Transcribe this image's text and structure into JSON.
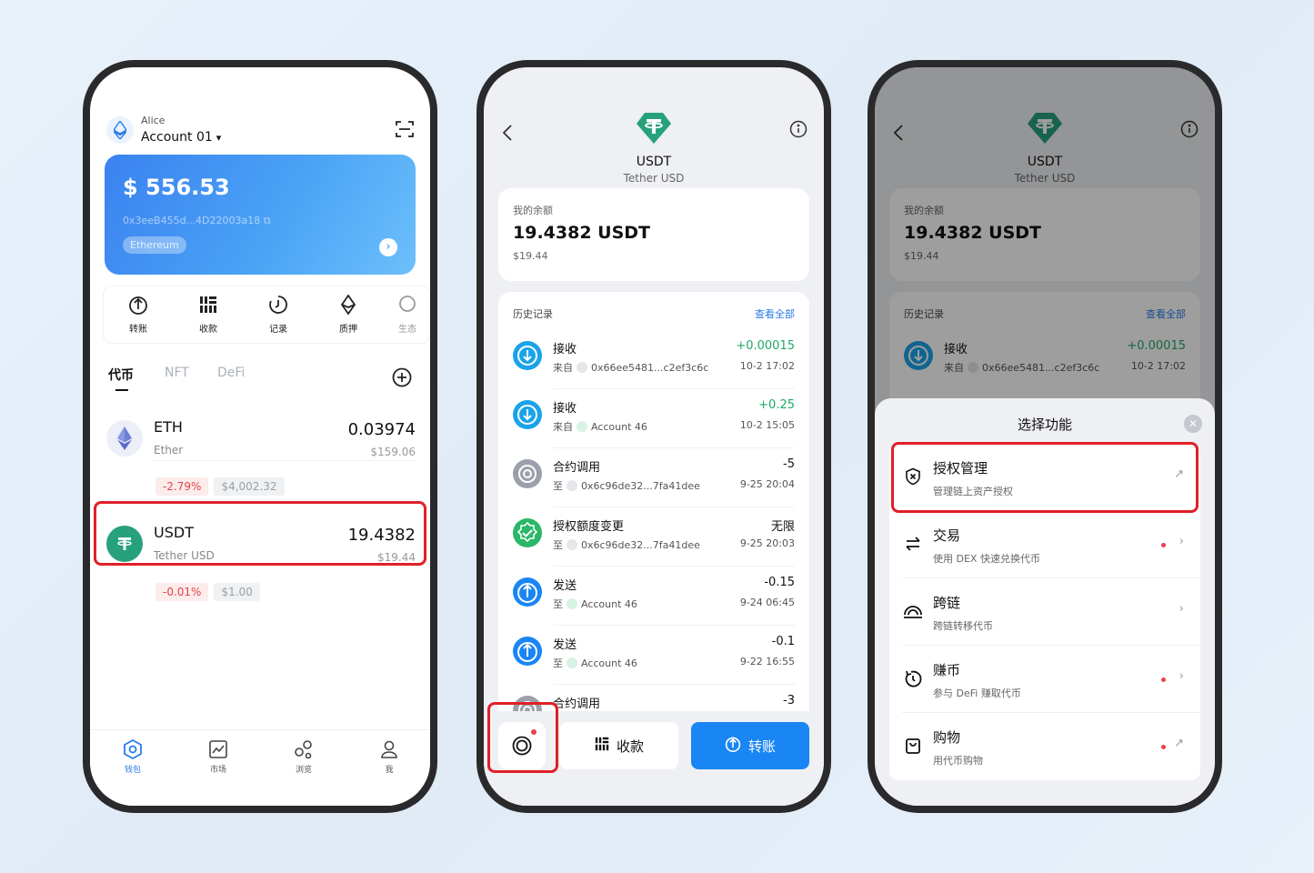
{
  "colors": {
    "accent": "#1a85f4",
    "positive": "#1fa868",
    "negative": "#e0454a",
    "highlight": "#e02028",
    "tether": "#26a17b"
  },
  "wallet": {
    "user": "Alice",
    "account": "Account 01",
    "balance": "$ 556.53",
    "address": "0x3eeB455d...4D22003a18",
    "network": "Ethereum",
    "actions": [
      {
        "label": "转账",
        "icon": "send-icon"
      },
      {
        "label": "收款",
        "icon": "qr-icon"
      },
      {
        "label": "记录",
        "icon": "history-icon"
      },
      {
        "label": "质押",
        "icon": "stake-icon"
      },
      {
        "label": "生态",
        "icon": "ecosystem-icon"
      }
    ],
    "tabs": [
      "代币",
      "NFT",
      "DeFi"
    ],
    "tokens": [
      {
        "symbol": "ETH",
        "name": "Ether",
        "balance": "0.03974",
        "usd": "$159.06",
        "change": "-2.79%",
        "price": "$4,002.32"
      },
      {
        "symbol": "USDT",
        "name": "Tether USD",
        "balance": "19.4382",
        "usd": "$19.44",
        "change": "-0.01%",
        "price": "$1.00"
      }
    ],
    "nav": [
      "钱包",
      "市场",
      "浏览",
      "我"
    ]
  },
  "detail": {
    "symbol": "USDT",
    "name": "Tether USD",
    "balance_label": "我的余额",
    "balance": "19.4382 USDT",
    "balance_usd": "$19.44",
    "history_label": "历史记录",
    "view_all": "查看全部",
    "transactions": [
      {
        "type": "接收",
        "dir": "来自",
        "addr": "0x66ee5481...c2ef3c6c",
        "amount": "+0.00015",
        "time": "10-2 17:02",
        "kind": "receive"
      },
      {
        "type": "接收",
        "dir": "来自",
        "addr": "Account 46",
        "amount": "+0.25",
        "time": "10-2 15:05",
        "kind": "receive"
      },
      {
        "type": "合约调用",
        "dir": "至",
        "addr": "0x6c96de32...7fa41dee",
        "amount": "-5",
        "time": "9-25 20:04",
        "kind": "contract"
      },
      {
        "type": "授权额度变更",
        "dir": "至",
        "addr": "0x6c96de32...7fa41dee",
        "amount": "无限",
        "time": "9-25 20:03",
        "kind": "approve"
      },
      {
        "type": "发送",
        "dir": "至",
        "addr": "Account 46",
        "amount": "-0.15",
        "time": "9-24 06:45",
        "kind": "send"
      },
      {
        "type": "发送",
        "dir": "至",
        "addr": "Account 46",
        "amount": "-0.1",
        "time": "9-22 16:55",
        "kind": "send"
      },
      {
        "type": "合约调用",
        "dir": "",
        "addr": "",
        "amount": "-3",
        "time": "",
        "kind": "contract"
      }
    ],
    "receive_label": "收款",
    "send_label": "转账"
  },
  "sheet": {
    "title": "选择功能",
    "items": [
      {
        "title": "授权管理",
        "desc": "管理链上资产授权",
        "icon": "shield-x-icon",
        "dot": false,
        "arrow": "↗"
      },
      {
        "title": "交易",
        "desc": "使用 DEX 快速兑换代币",
        "icon": "swap-icon",
        "dot": true,
        "arrow": "›"
      },
      {
        "title": "跨链",
        "desc": "跨链转移代币",
        "icon": "bridge-icon",
        "dot": false,
        "arrow": "›"
      },
      {
        "title": "赚币",
        "desc": "参与 DeFi 赚取代币",
        "icon": "earn-icon",
        "dot": true,
        "arrow": "›"
      },
      {
        "title": "购物",
        "desc": "用代币购物",
        "icon": "shopping-bag-icon",
        "dot": true,
        "arrow": "↗"
      }
    ]
  }
}
